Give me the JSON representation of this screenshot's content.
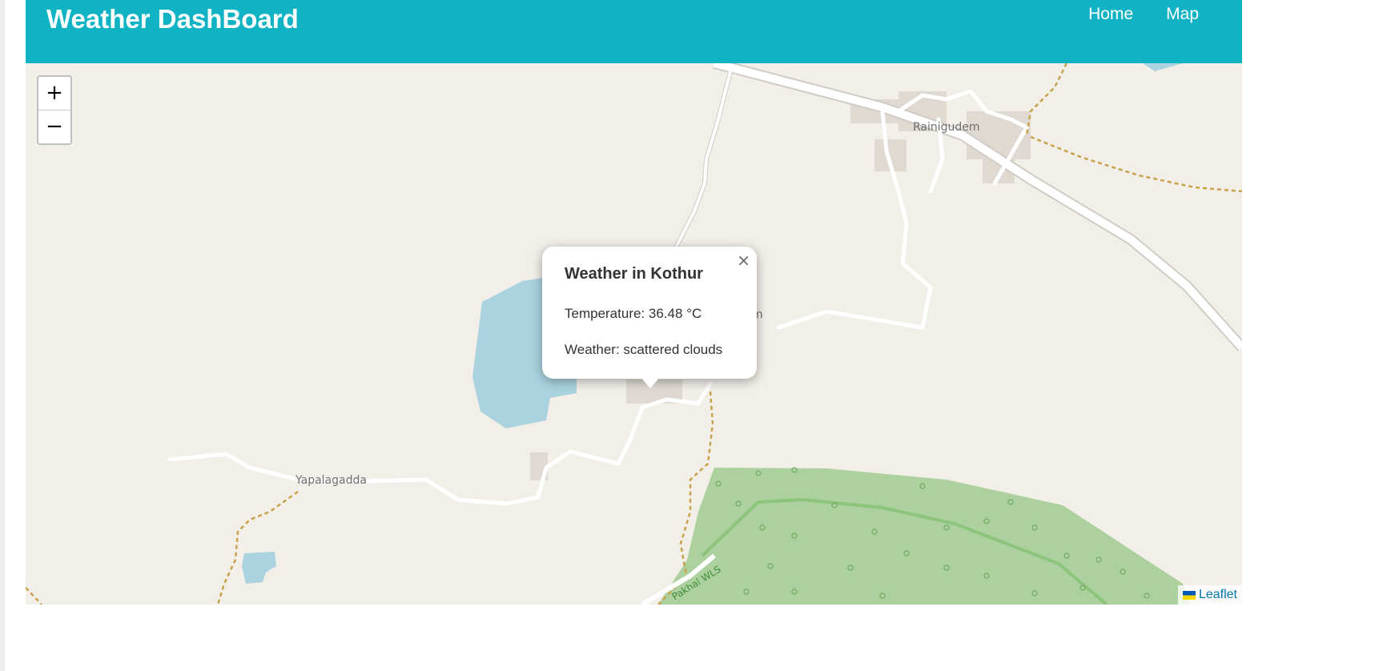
{
  "app": {
    "title": "Weather DashBoard"
  },
  "nav": {
    "items": [
      {
        "label": "Home"
      },
      {
        "label": "Map"
      }
    ]
  },
  "map": {
    "zoom_in": "+",
    "zoom_out": "−",
    "labels": {
      "village_1": "Rainigudem",
      "village_2": "Yapalagadda",
      "village_3": "m",
      "park": "Pakhal WLS"
    },
    "attribution": "Leaflet"
  },
  "popup": {
    "title": "Weather in Kothur",
    "temperature": "Temperature: 36.48 °C",
    "weather": "Weather: scattered clouds",
    "close": "×"
  },
  "colors": {
    "navbar": "#0fb3c4",
    "map_bg": "#f2efe9",
    "water": "#aad3df",
    "forest": "#add19e",
    "road": "#ffffff",
    "path": "#c8a24a"
  }
}
